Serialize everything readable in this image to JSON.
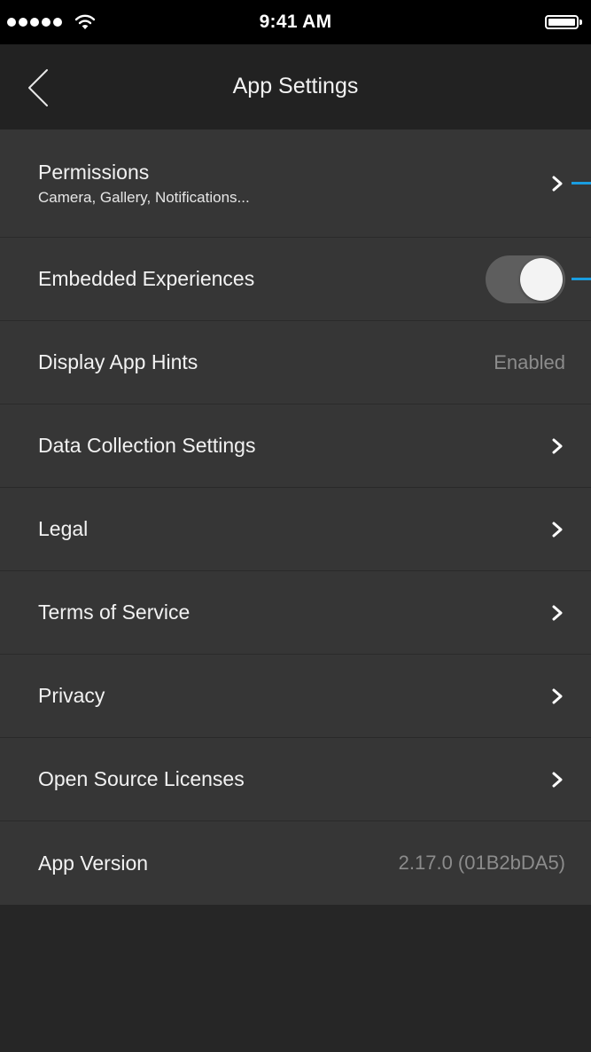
{
  "status_bar": {
    "time": "9:41 AM",
    "signal_icon": "signal-dots-icon",
    "wifi_icon": "wifi-icon",
    "battery_icon": "battery-full-icon",
    "battery_level": 1.0
  },
  "nav": {
    "title": "App Settings",
    "back_icon": "chevron-left-icon"
  },
  "settings": {
    "permissions": {
      "label": "Permissions",
      "sublabel": "Camera, Gallery, Notifications..."
    },
    "embedded_experiences": {
      "label": "Embedded Experiences",
      "toggle_on": true
    },
    "display_app_hints": {
      "label": "Display App Hints",
      "value": "Enabled"
    },
    "data_collection": {
      "label": "Data Collection Settings"
    },
    "legal": {
      "label": "Legal"
    },
    "terms": {
      "label": "Terms of Service"
    },
    "privacy": {
      "label": "Privacy"
    },
    "open_source": {
      "label": "Open Source Licenses"
    },
    "app_version": {
      "label": "App Version",
      "value": "2.17.0 (01B2bDA5)"
    }
  },
  "colors": {
    "background": "#262626",
    "list_background": "#363636",
    "nav_background": "#222222",
    "accent_marker": "#1a9de0",
    "secondary_text": "#8c8c8c"
  }
}
